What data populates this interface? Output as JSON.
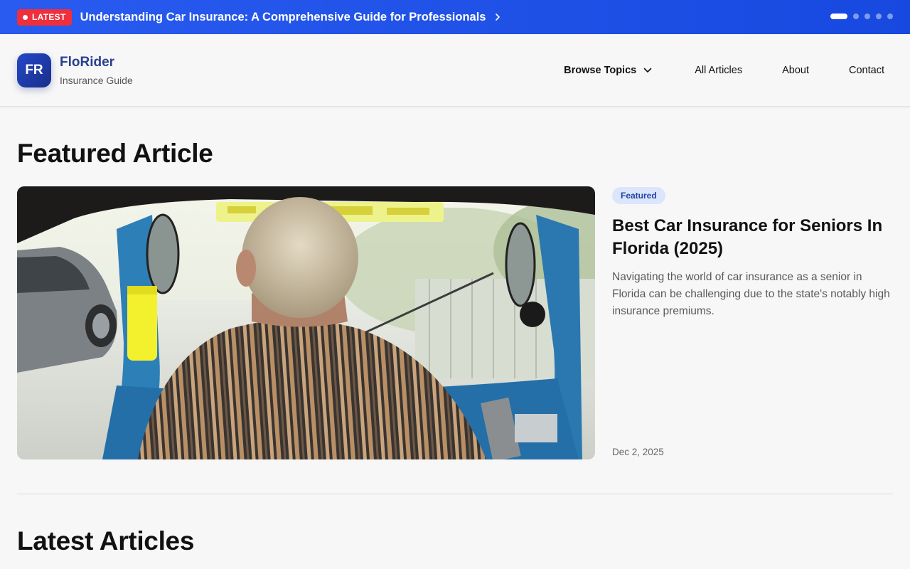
{
  "topbar": {
    "badge_label": "LATEST",
    "headline": "Understanding Car Insurance: A Comprehensive Guide for Professionals",
    "slides_total": 5,
    "slides_active": 1
  },
  "header": {
    "logo_initials": "FR",
    "brand_name": "FloRider",
    "brand_tagline": "Insurance Guide"
  },
  "nav": {
    "browse_topics": "Browse Topics",
    "all_articles": "All Articles",
    "about": "About",
    "contact": "Contact"
  },
  "featured": {
    "section_title": "Featured Article",
    "tag": "Featured",
    "title": "Best Car Insurance for Seniors In Florida (2025)",
    "excerpt": "Navigating the world of car insurance as a senior in Florida can be challenging due to the state's notably high insurance premiums.",
    "date": "Dec 2, 2025"
  },
  "latest": {
    "section_title": "Latest Articles"
  },
  "colors": {
    "topbar": "#1d4ee8",
    "badge": "#ef2f3b",
    "brand": "#2a3f8f",
    "tag_bg": "#dbe5fb"
  }
}
